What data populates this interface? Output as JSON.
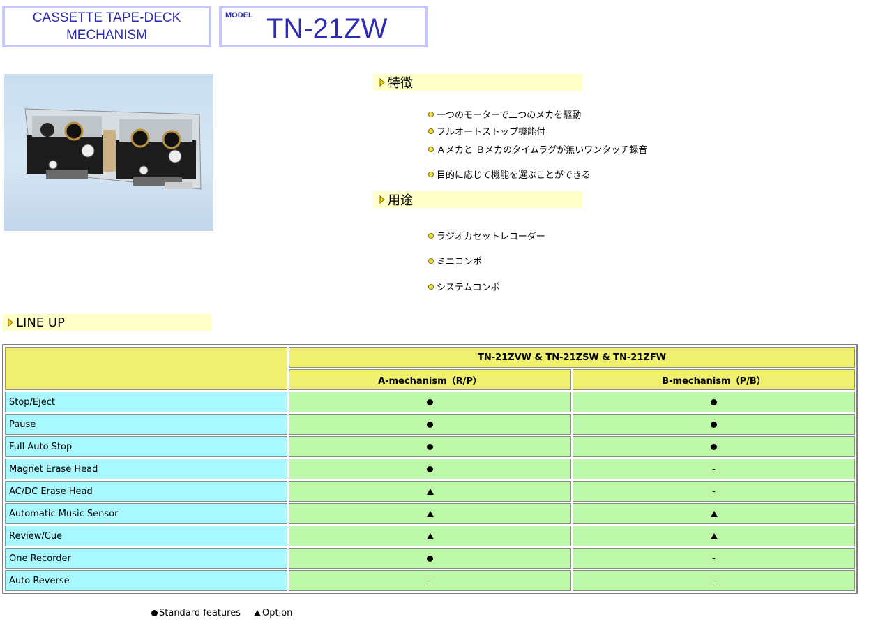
{
  "header": {
    "title_line1": "CASSETTE TAPE-DECK",
    "title_line2": "MECHANISM",
    "model_label": "MODEL",
    "model_name": "TN-21ZW"
  },
  "features": {
    "heading": "特徴",
    "items": [
      "一つのモーターで二つのメカを駆動",
      "フルオートストップ機能付",
      "Ａメカと Ｂメカのタイムラグが無いワンタッチ録音",
      "目的に応じて機能を選ぶことができる"
    ]
  },
  "uses": {
    "heading": "用途",
    "items": [
      "ラジオカセットレコーダー",
      "ミニコンポ",
      "システムコンポ"
    ]
  },
  "lineup": {
    "heading": "LINE UP",
    "model_header": "TN-21ZVW & TN-21ZSW & TN-21ZFW",
    "col_a": "A-mechanism（R/P）",
    "col_b": "B-mechanism（P/B）",
    "rows": [
      {
        "label": "Stop/Eject",
        "a": "●",
        "b": "●"
      },
      {
        "label": "Pause",
        "a": "●",
        "b": "●"
      },
      {
        "label": "Full Auto Stop",
        "a": "●",
        "b": "●"
      },
      {
        "label": "Magnet Erase Head",
        "a": "●",
        "b": "-"
      },
      {
        "label": "AC/DC Erase Head",
        "a": "▲",
        "b": "-"
      },
      {
        "label": "Automatic Music Sensor",
        "a": "▲",
        "b": "▲"
      },
      {
        "label": "Review/Cue",
        "a": "▲",
        "b": "▲"
      },
      {
        "label": "One Recorder",
        "a": "●",
        "b": "-"
      },
      {
        "label": "Auto Reverse",
        "a": "-",
        "b": "-"
      }
    ]
  },
  "legend": {
    "standard": "Standard features",
    "option": "Option"
  },
  "colors": {
    "title_blue": "#2b2bb4",
    "section_bg": "#ffffc8",
    "header_yellow": "#f0f070",
    "label_cyan": "#a8f8ff",
    "cell_green": "#bcf8a8"
  },
  "icons": {
    "section_arrow": "triangle-right-icon",
    "bullet": "yellow-dot-icon",
    "standard": "black-circle-icon",
    "option": "black-triangle-icon"
  }
}
